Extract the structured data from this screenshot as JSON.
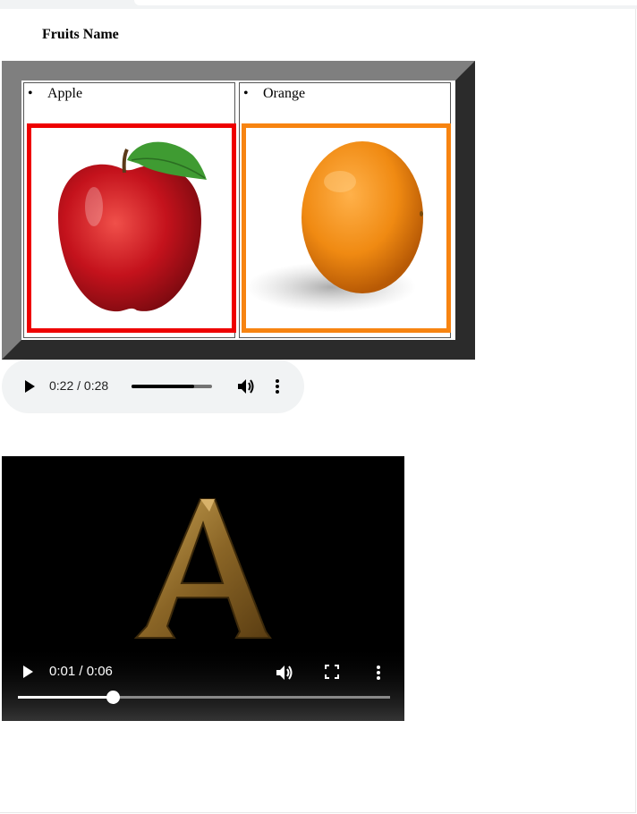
{
  "heading": "Fruits Name",
  "fruits": [
    {
      "name": "Apple",
      "border_color": "#ee0000",
      "image_icon": "apple-image"
    },
    {
      "name": "Orange",
      "border_color": "#f78411",
      "image_icon": "orange-image"
    }
  ],
  "audio": {
    "time": "0:22 / 0:28",
    "progress": 0.78
  },
  "video": {
    "time": "0:01 / 0:06",
    "progress": 0.26,
    "frame_icon": "golden-letter-image"
  }
}
